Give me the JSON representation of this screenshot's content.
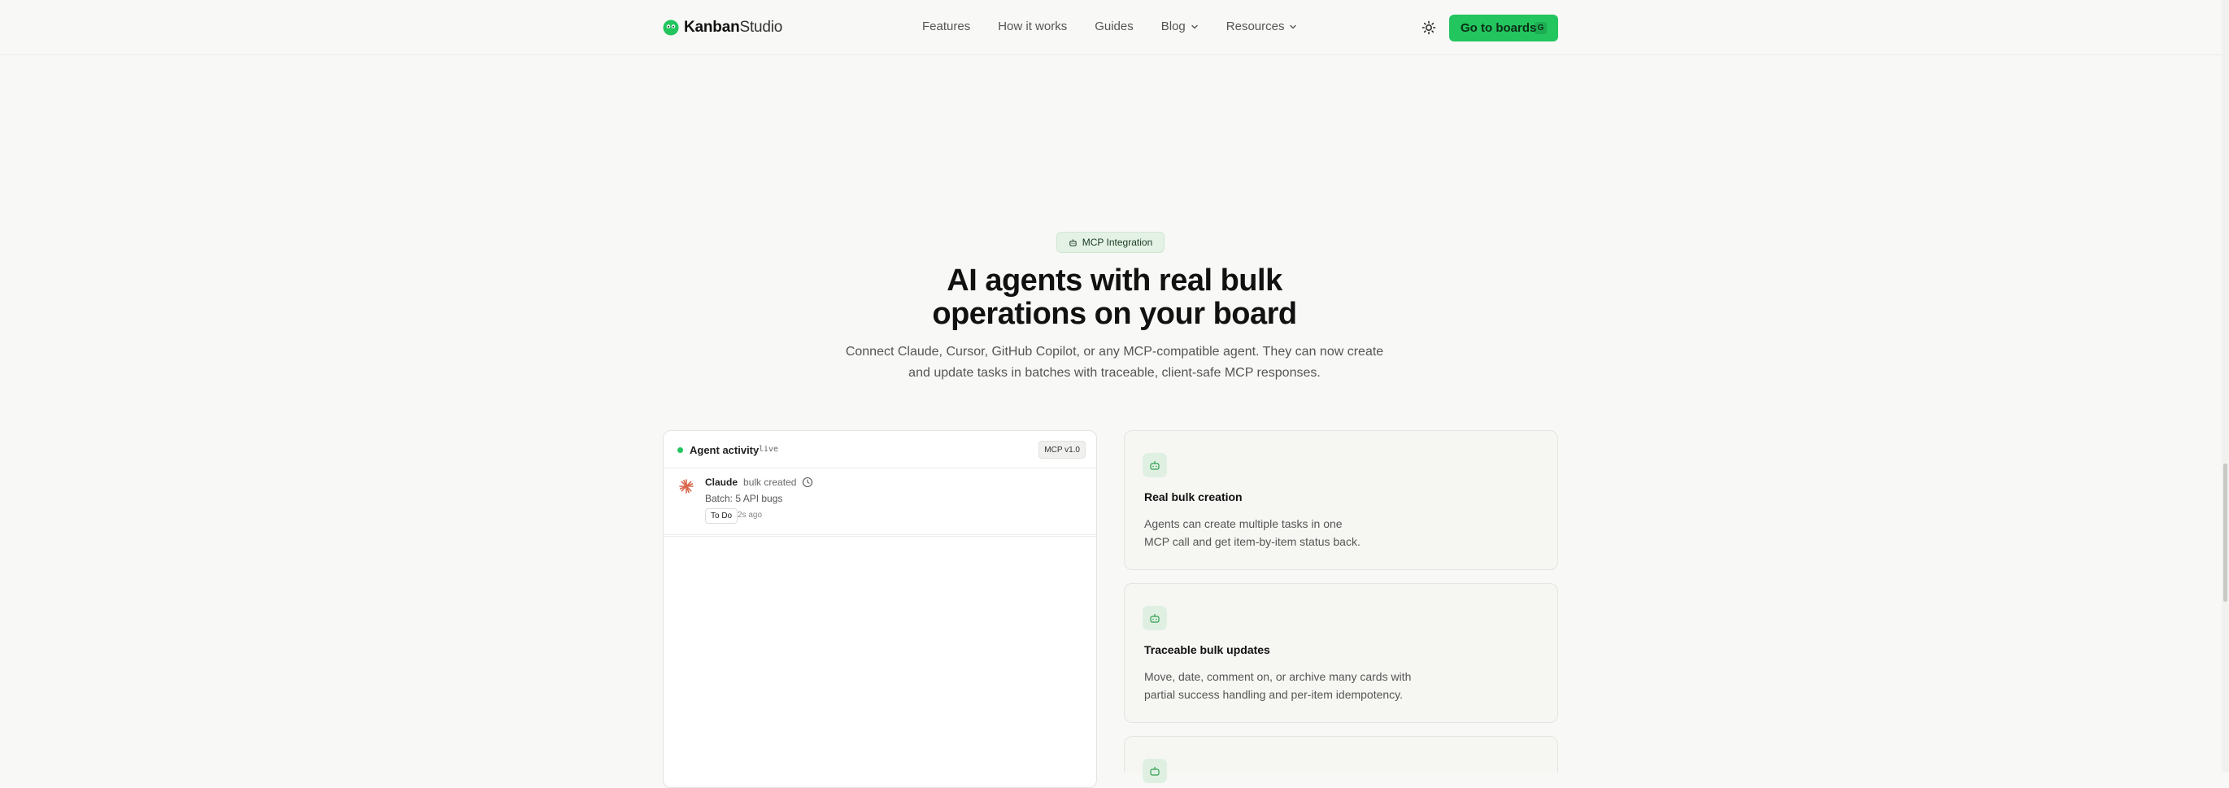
{
  "brand": {
    "name_bold": "Kanban",
    "name_light": "Studio"
  },
  "nav": {
    "links": [
      {
        "label": "Features"
      },
      {
        "label": "How it works"
      },
      {
        "label": "Guides"
      },
      {
        "label": "Blog",
        "dropdown": true
      },
      {
        "label": "Resources",
        "dropdown": true
      }
    ],
    "cta_label": "Go to boards",
    "cta_shortcut": "G",
    "accent_color": "#22c55e"
  },
  "hero": {
    "badge": "MCP Integration",
    "title_line1": "AI agents with real bulk",
    "title_line2": "operations on your board",
    "subtitle_line1": "Connect Claude, Cursor, GitHub Copilot, or any MCP-compatible agent. They can now create",
    "subtitle_line2": "and update tasks in batches with traceable, client-safe MCP responses."
  },
  "activity_panel": {
    "title": "Agent activity",
    "live_label": "live",
    "version": "MCP v1.0",
    "items": [
      {
        "agent": "Claude",
        "action": "bulk created",
        "detail": "Batch: 5 API bugs",
        "status": "To Do",
        "time": "2s ago"
      }
    ]
  },
  "features": [
    {
      "title": "Real bulk creation",
      "desc_line1": "Agents can create multiple tasks in one",
      "desc_line2": "MCP call and get item-by-item status back.",
      "icon": "bot-icon"
    },
    {
      "title": "Traceable bulk updates",
      "desc_line1": "Move, date, comment on, or archive many cards with",
      "desc_line2": "partial success handling and per-item idempotency.",
      "icon": "bot-icon"
    },
    {
      "title": "",
      "desc_line1": "",
      "desc_line2": "",
      "icon": "bot-icon"
    }
  ]
}
